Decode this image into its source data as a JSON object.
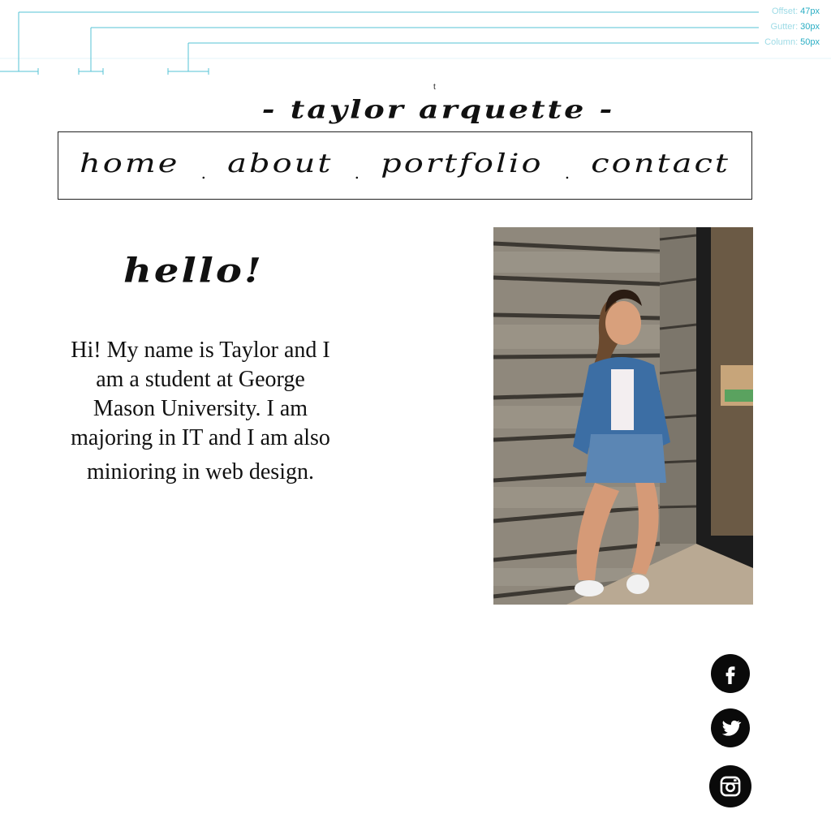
{
  "guides": {
    "offset": {
      "label": "Offset:",
      "value": "47px"
    },
    "gutter": {
      "label": "Gutter:",
      "value": "30px"
    },
    "column": {
      "label": "Column:",
      "value": "50px"
    }
  },
  "stray_text": "t",
  "site_title": "- taylor arquette -",
  "nav": {
    "items": [
      "home",
      "about",
      "portfolio",
      "contact"
    ],
    "separator": "."
  },
  "greeting": "hello!",
  "intro_lines": [
    "Hi! My name is Taylor and I",
    "am a student at George",
    "Mason University. I am",
    "majoring in IT and I am also",
    "minioring in web design."
  ],
  "social": [
    {
      "icon": "facebook-icon"
    },
    {
      "icon": "twitter-icon"
    },
    {
      "icon": "instagram-icon"
    }
  ],
  "colors": {
    "guide": "#2aaec4",
    "guide_light": "#9edbe6",
    "ink": "#111111",
    "icon_bg": "#0a0a0a"
  }
}
